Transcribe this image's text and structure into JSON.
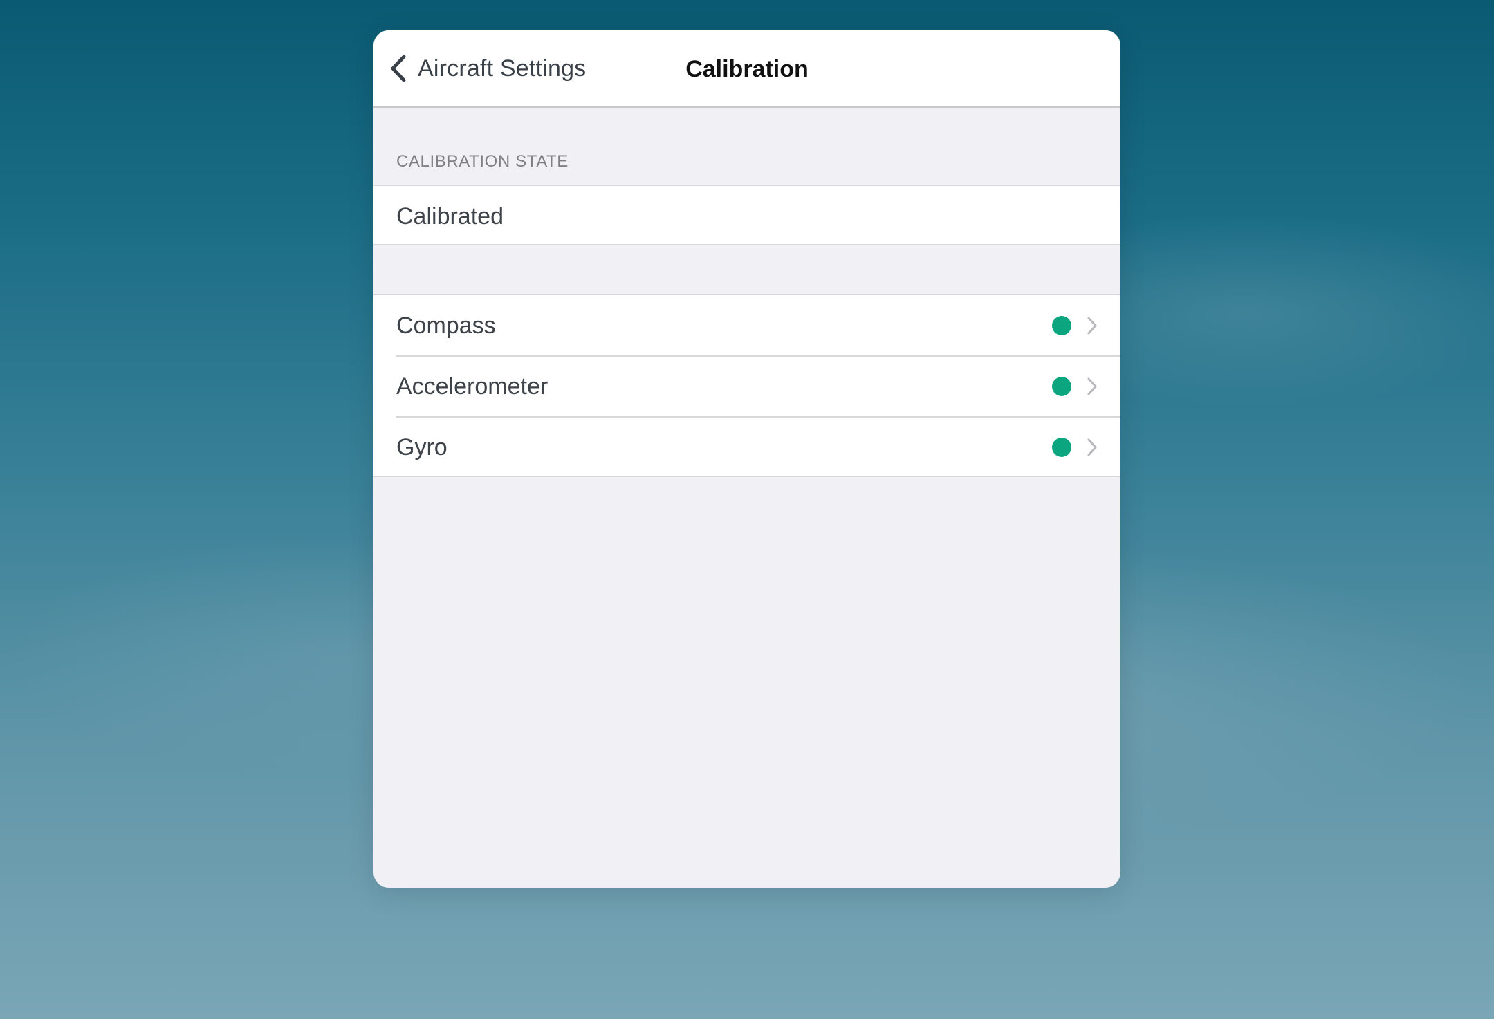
{
  "nav": {
    "back_label": "Aircraft Settings",
    "title": "Calibration"
  },
  "state_section": {
    "header": "CALIBRATION STATE",
    "value": "Calibrated"
  },
  "sensors": [
    {
      "label": "Compass",
      "status_color": "#0ba57f",
      "icon": "chevron-right-icon"
    },
    {
      "label": "Accelerometer",
      "status_color": "#0ba57f",
      "icon": "chevron-right-icon"
    },
    {
      "label": "Gyro",
      "status_color": "#0ba57f",
      "icon": "chevron-right-icon"
    }
  ],
  "colors": {
    "status_ok": "#0ba57f",
    "panel_bg": "#f1f0f5",
    "separator": "#d8d7dc"
  }
}
